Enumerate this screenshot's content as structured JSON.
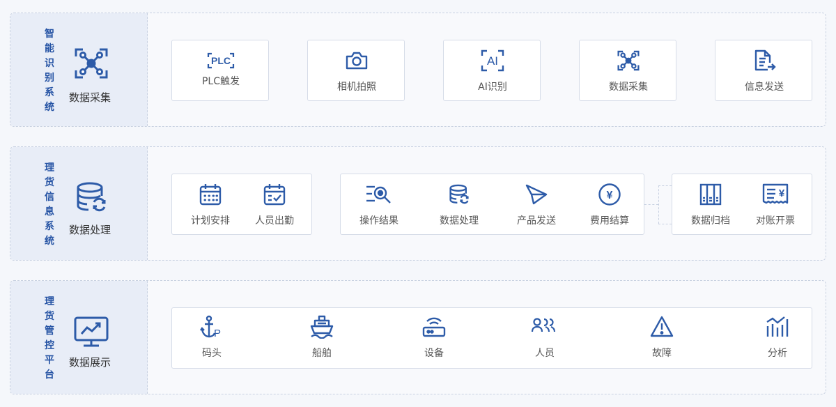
{
  "section1": {
    "title": "智能识别系统",
    "left_label": "数据采集",
    "items": [
      {
        "label": "PLC触发",
        "icon": "plc-icon",
        "icon_text": "PLC"
      },
      {
        "label": "相机拍照",
        "icon": "camera-icon"
      },
      {
        "label": "AI识别",
        "icon": "ai-icon",
        "icon_text": "AI"
      },
      {
        "label": "数据采集",
        "icon": "data-collect-icon"
      },
      {
        "label": "信息发送",
        "icon": "document-send-icon"
      }
    ]
  },
  "section2": {
    "title": "理货信息系统",
    "left_label": "数据处理",
    "group1": [
      {
        "label": "计划安排",
        "icon": "calendar-icon"
      },
      {
        "label": "人员出勤",
        "icon": "calendar-check-icon"
      }
    ],
    "group2": [
      {
        "label": "操作结果",
        "icon": "search-list-icon"
      },
      {
        "label": "数据处理",
        "icon": "database-sync-icon"
      },
      {
        "label": "产品发送",
        "icon": "paper-plane-icon"
      },
      {
        "label": "费用结算",
        "icon": "yen-circle-icon",
        "icon_text": "¥"
      }
    ],
    "group3": [
      {
        "label": "数据归档",
        "icon": "archive-icon"
      },
      {
        "label": "对账开票",
        "icon": "invoice-icon",
        "icon_text": "¥"
      }
    ]
  },
  "section3": {
    "title": "理货管控平台",
    "left_label": "数据展示",
    "items": [
      {
        "label": "码头",
        "icon": "anchor-icon",
        "icon_text": "P"
      },
      {
        "label": "船舶",
        "icon": "ship-icon"
      },
      {
        "label": "设备",
        "icon": "router-icon"
      },
      {
        "label": "人员",
        "icon": "people-icon"
      },
      {
        "label": "故障",
        "icon": "warning-icon"
      },
      {
        "label": "分析",
        "icon": "bar-chart-icon"
      }
    ]
  },
  "colors": {
    "accent": "#2553a4",
    "icon": "#2d5ba8",
    "left_bg": "#e8edf7",
    "border": "#c8d1e1"
  }
}
